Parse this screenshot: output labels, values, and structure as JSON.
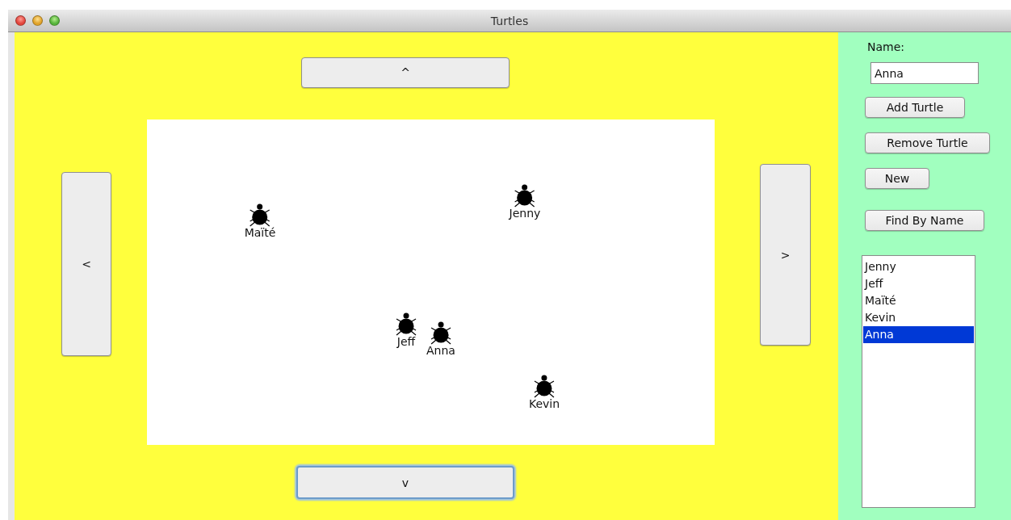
{
  "window": {
    "title": "Turtles"
  },
  "move_buttons": {
    "up": {
      "label": "^",
      "focused": false
    },
    "left": {
      "label": "<",
      "focused": false
    },
    "right": {
      "label": ">",
      "focused": false
    },
    "down": {
      "label": "v",
      "focused": true
    }
  },
  "canvas": {
    "turtles": [
      {
        "name": "Maïté"
      },
      {
        "name": "Jenny"
      },
      {
        "name": "Jeff"
      },
      {
        "name": "Anna"
      },
      {
        "name": "Kevin"
      }
    ]
  },
  "sidebar": {
    "name_label": "Name:",
    "name_field": {
      "value": "Anna"
    },
    "buttons": [
      "Add Turtle",
      "Remove Turtle",
      "New",
      "Find By Name"
    ],
    "list": [
      {
        "label": "Jenny",
        "selected": false
      },
      {
        "label": "Jeff",
        "selected": false
      },
      {
        "label": "Maïté",
        "selected": false
      },
      {
        "label": "Kevin",
        "selected": false
      },
      {
        "label": "Anna",
        "selected": true
      }
    ]
  }
}
